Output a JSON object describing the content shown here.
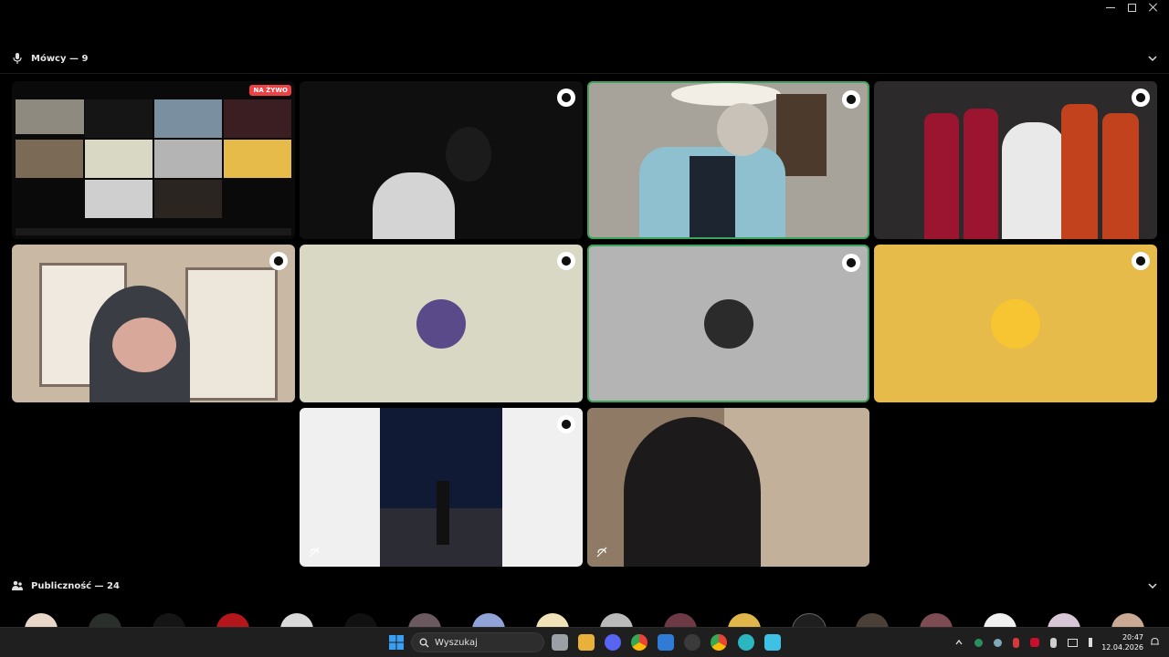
{
  "speakers_header": {
    "label": "Mówcy — 9"
  },
  "audience_header": {
    "label": "Publiczność — 24"
  },
  "live_badge": "NA ŻYWO",
  "colors": {
    "speaking_border": "#3ba55c",
    "live_red": "#ed4245",
    "tile_beige": "#d8d8c4",
    "tile_gray": "#b5b4b4",
    "tile_yellow": "#e6bb4a"
  },
  "taskbar": {
    "search_placeholder": "Wyszukaj",
    "time": "20:47",
    "date": "12.04.2026"
  }
}
